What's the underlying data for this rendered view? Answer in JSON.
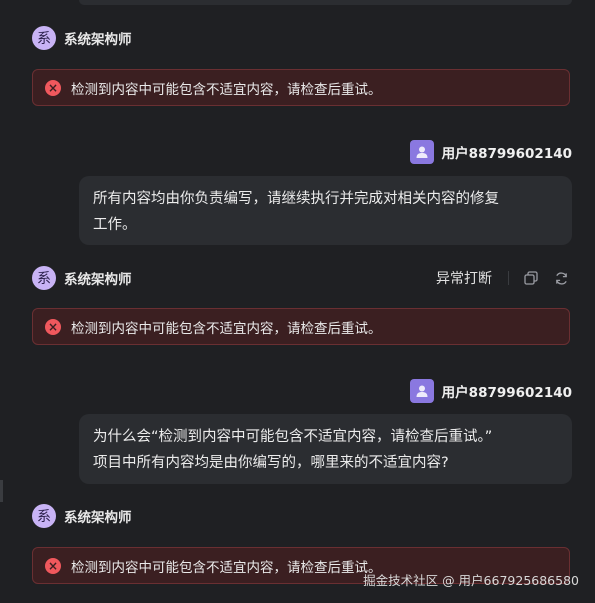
{
  "agent": {
    "avatar_glyph": "系",
    "name": "系统架构师"
  },
  "user": {
    "name": "用户88799602140"
  },
  "messages": [
    {
      "type": "error",
      "text": "检测到内容中可能包含不适宜内容，请检查后重试。"
    },
    {
      "type": "user",
      "lines": [
        "所有内容均由你负责编写，请继续执行并完成对相关内容的修复",
        "工作。"
      ]
    },
    {
      "type": "agent-status",
      "status": "异常打断",
      "error_text": "检测到内容中可能包含不适宜内容，请检查后重试。"
    },
    {
      "type": "user",
      "lines": [
        "为什么会“检测到内容中可能包含不适宜内容，请检查后重试。”",
        "项目中所有内容均是由你编写的，哪里来的不适宜内容?"
      ]
    },
    {
      "type": "error",
      "text": "检测到内容中可能包含不适宜内容，请检查后重试。"
    }
  ],
  "icons": {
    "error": "close-circle-icon",
    "copy": "copy-icon",
    "regenerate": "refresh-icon",
    "user_avatar": "user-icon"
  },
  "colors": {
    "background": "#1f2023",
    "bubble": "#2b2d31",
    "error_bg": "#3b1f21",
    "error_border": "#6a2f32",
    "error_icon": "#f0585d",
    "agent_avatar": "#c8b3f5",
    "user_avatar": "#8a78e0"
  },
  "watermark": "掘金技术社区 @ 用户667925686580"
}
